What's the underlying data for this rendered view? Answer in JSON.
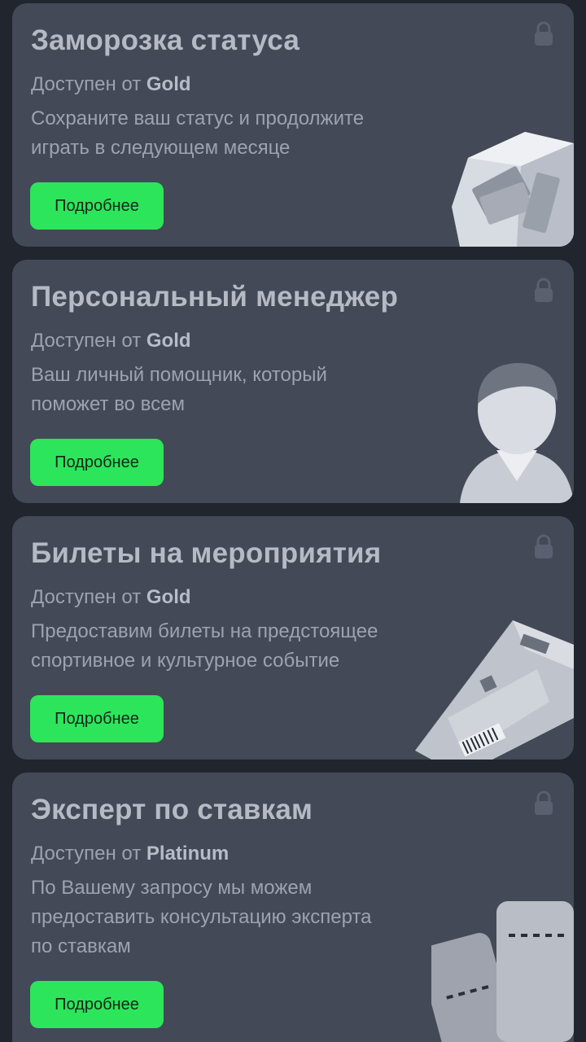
{
  "cards": [
    {
      "title": "Заморозка статуса",
      "avail_prefix": "Доступен от",
      "avail_tier": "Gold",
      "desc": [
        "Сохраните ваш статус и продолжите",
        "играть в следующем месяце"
      ],
      "button": "Подробнее",
      "icon": "ice-cube-money-icon"
    },
    {
      "title": "Персональный менеджер",
      "avail_prefix": "Доступен от",
      "avail_tier": "Gold",
      "desc": [
        "Ваш личный помощник, который",
        "поможет во всем"
      ],
      "button": "Подробнее",
      "icon": "person-manager-icon"
    },
    {
      "title": "Билеты на мероприятия",
      "avail_prefix": "Доступен от",
      "avail_tier": "Gold",
      "desc": [
        "Предоставим билеты на предстоящее",
        "спортивное и культурное событие"
      ],
      "button": "Подробнее",
      "icon": "ticket-icon"
    },
    {
      "title": "Эксперт по ставкам",
      "avail_prefix": "Доступен от",
      "avail_tier": "Platinum",
      "desc": [
        "По Вашему запросу мы можем",
        "предоставить консультацию эксперта",
        "по ставкам"
      ],
      "button": "Подробнее",
      "icon": "bet-cards-icon"
    }
  ],
  "colors": {
    "background": "#20252e",
    "card": "#434956",
    "button": "#2de55b",
    "title": "#b5bac4",
    "text": "#9da3ae"
  }
}
